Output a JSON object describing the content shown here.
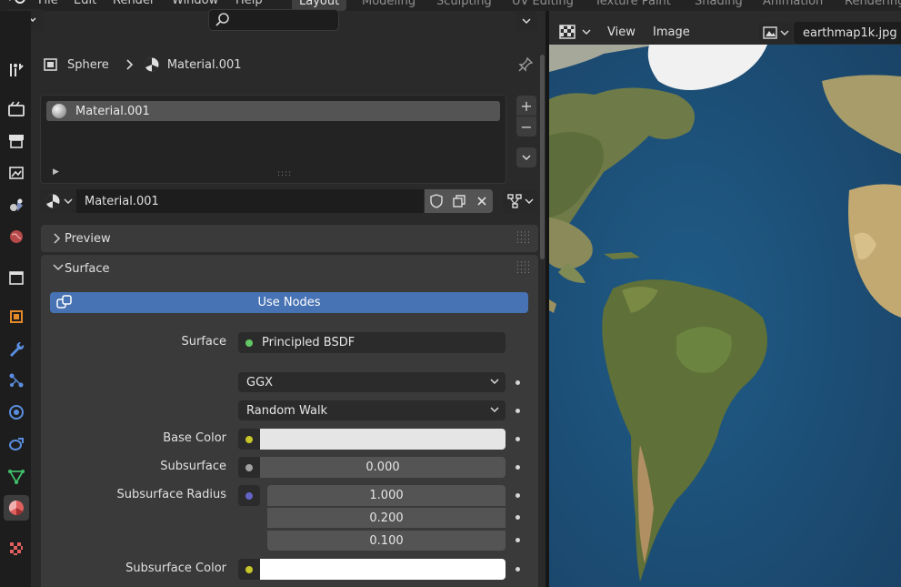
{
  "top_menu": [
    "File",
    "Edit",
    "Render",
    "Window",
    "Help"
  ],
  "workspaces": [
    "Layout",
    "Modeling",
    "Sculpting",
    "UV Editing",
    "Texture Paint",
    "Shading",
    "Animation",
    "Rendering"
  ],
  "active_workspace": "Layout",
  "breadcrumb": {
    "object": "Sphere",
    "material": "Material.001"
  },
  "material_slots": [
    "Material.001"
  ],
  "material_datablock": "Material.001",
  "sections": {
    "preview": "Preview",
    "surface": "Surface"
  },
  "use_nodes_label": "Use Nodes",
  "surface": {
    "label": "Surface",
    "shader": "Principled BSDF",
    "distribution": "GGX",
    "subsurface_method": "Random Walk",
    "base_color_label": "Base Color",
    "subsurface_label": "Subsurface",
    "subsurface_value": "0.000",
    "subsurface_radius_label": "Subsurface Radius",
    "subsurface_radius": [
      "1.000",
      "0.200",
      "0.100"
    ],
    "subsurface_color_label": "Subsurface Color"
  },
  "image_editor": {
    "view_menu": "View",
    "image_menu": "Image",
    "image_name": "earthmap1k.jpg"
  },
  "colors": {
    "accent": "#4772b3",
    "socket_green": "#63c763",
    "socket_yellow": "#c7c729",
    "socket_gray": "#a1a1a1",
    "socket_purple": "#6363c7"
  }
}
